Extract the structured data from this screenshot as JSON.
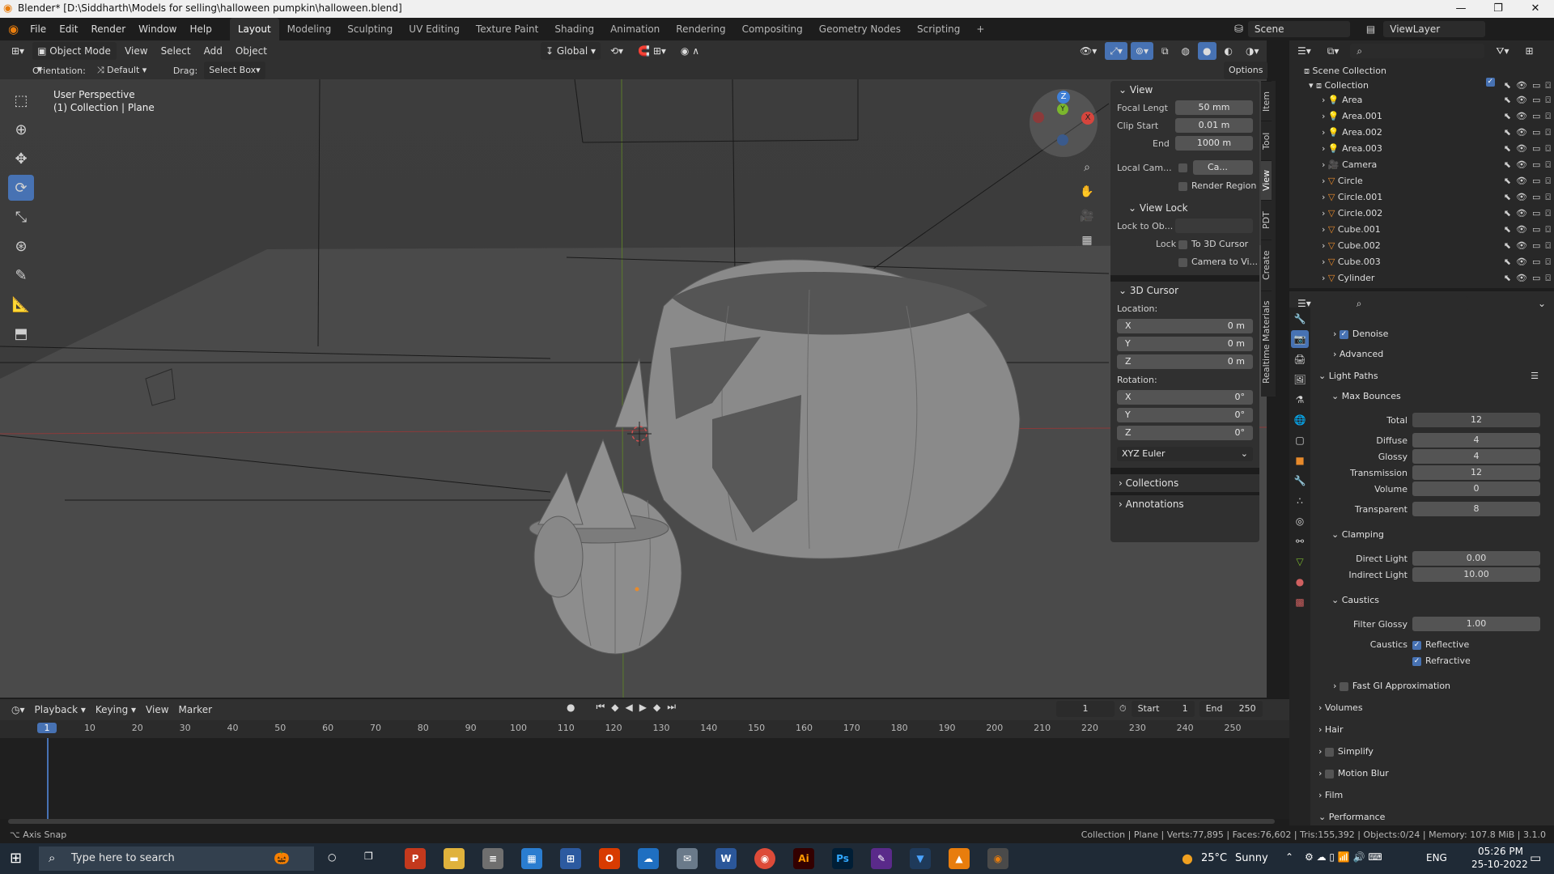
{
  "window": {
    "title": "Blender* [D:\\Siddharth\\Models for selling\\halloween pumpkin\\halloween.blend]",
    "minimize": "—",
    "maximize": "❐",
    "close": "✕"
  },
  "menu": [
    "File",
    "Edit",
    "Render",
    "Window",
    "Help"
  ],
  "workspaces": [
    "Layout",
    "Modeling",
    "Sculpting",
    "UV Editing",
    "Texture Paint",
    "Shading",
    "Animation",
    "Rendering",
    "Compositing",
    "Geometry Nodes",
    "Scripting",
    "+"
  ],
  "scene": {
    "scene_name": "Scene",
    "view_layer": "ViewLayer"
  },
  "vp_header": {
    "mode": "Object Mode",
    "menus": [
      "View",
      "Select",
      "Add",
      "Object"
    ],
    "transform_orientation": "Global",
    "orientation_label": "Orientation:",
    "orientation_value": "Default",
    "drag_label": "Drag:",
    "drag_value": "Select Box",
    "options": "Options"
  },
  "viewport": {
    "perspective": "User Perspective",
    "collection": "(1) Collection | Plane"
  },
  "gizmo": {
    "x": "X",
    "y": "Y",
    "z": "Z"
  },
  "npanel": {
    "tabs": [
      "Item",
      "Tool",
      "View",
      "PDT",
      "Create",
      "Realtime Materials"
    ],
    "view_header": "View",
    "focal_label": "Focal Lengt",
    "focal_value": "50 mm",
    "clip_start_label": "Clip Start",
    "clip_start_value": "0.01 m",
    "end_label": "End",
    "end_value": "1000 m",
    "local_cam_label": "Local Cam...",
    "local_cam_value": "Ca...",
    "render_region": "Render Region",
    "view_lock_header": "View Lock",
    "lock_to_obj_label": "Lock to Ob...",
    "lock_label": "Lock",
    "to_3d_cursor": "To 3D Cursor",
    "camera_to_view": "Camera to Vi...",
    "cursor_header": "3D Cursor",
    "location_label": "Location:",
    "loc": [
      {
        "axis": "X",
        "value": "0 m"
      },
      {
        "axis": "Y",
        "value": "0 m"
      },
      {
        "axis": "Z",
        "value": "0 m"
      }
    ],
    "rotation_label": "Rotation:",
    "rot": [
      {
        "axis": "X",
        "value": "0°"
      },
      {
        "axis": "Y",
        "value": "0°"
      },
      {
        "axis": "Z",
        "value": "0°"
      }
    ],
    "euler": "XYZ Euler",
    "collections": "Collections",
    "annotations": "Annotations"
  },
  "outliner": {
    "scene_collection": "Scene Collection",
    "collection": "Collection",
    "items": [
      "Area",
      "Area.001",
      "Area.002",
      "Area.003",
      "Camera",
      "Circle",
      "Circle.001",
      "Circle.002",
      "Cube.001",
      "Cube.002",
      "Cube.003",
      "Cylinder"
    ]
  },
  "properties": {
    "denoise": "Denoise",
    "advanced": "Advanced",
    "light_paths": "Light Paths",
    "max_bounces": "Max Bounces",
    "total_label": "Total",
    "total": "12",
    "diffuse_label": "Diffuse",
    "diffuse": "4",
    "glossy_label": "Glossy",
    "glossy": "4",
    "transmission_label": "Transmission",
    "transmission": "12",
    "volume_label": "Volume",
    "volume": "0",
    "transparent_label": "Transparent",
    "transparent": "8",
    "clamping": "Clamping",
    "direct_label": "Direct Light",
    "direct": "0.00",
    "indirect_label": "Indirect Light",
    "indirect": "10.00",
    "caustics": "Caustics",
    "filter_glossy_label": "Filter Glossy",
    "filter_glossy": "1.00",
    "caustics_label": "Caustics",
    "reflective": "Reflective",
    "refractive": "Refractive",
    "fast_gi": "Fast GI Approximation",
    "volumes": "Volumes",
    "hair": "Hair",
    "simplify": "Simplify",
    "motion_blur": "Motion Blur",
    "film": "Film",
    "performance": "Performance"
  },
  "timeline": {
    "menus": [
      "Playback",
      "Keying",
      "View",
      "Marker"
    ],
    "current_frame": "1",
    "start_label": "Start",
    "start": "1",
    "end_label": "End",
    "end": "250",
    "ticks": [
      "1",
      "10",
      "20",
      "30",
      "40",
      "50",
      "60",
      "70",
      "80",
      "90",
      "100",
      "110",
      "120",
      "130",
      "140",
      "150",
      "160",
      "170",
      "180",
      "190",
      "200",
      "210",
      "220",
      "230",
      "240",
      "250"
    ]
  },
  "status": {
    "left": "Axis Snap",
    "right": "Collection | Plane | Verts:77,895 | Faces:76,602 | Tris:155,392 | Objects:0/24 | Memory: 107.8 MiB | 3.1.0"
  },
  "taskbar": {
    "search_placeholder": "Type here to search",
    "weather_temp": "25°C",
    "weather_text": "Sunny",
    "lang": "ENG",
    "time": "05:26 PM",
    "date": "25-10-2022"
  },
  "colors": {
    "accent": "#4772b3",
    "selected": "#e88a2b",
    "x_axis": "#d6453d",
    "y_axis": "#7bb62d",
    "z_axis": "#3f7fd6"
  }
}
